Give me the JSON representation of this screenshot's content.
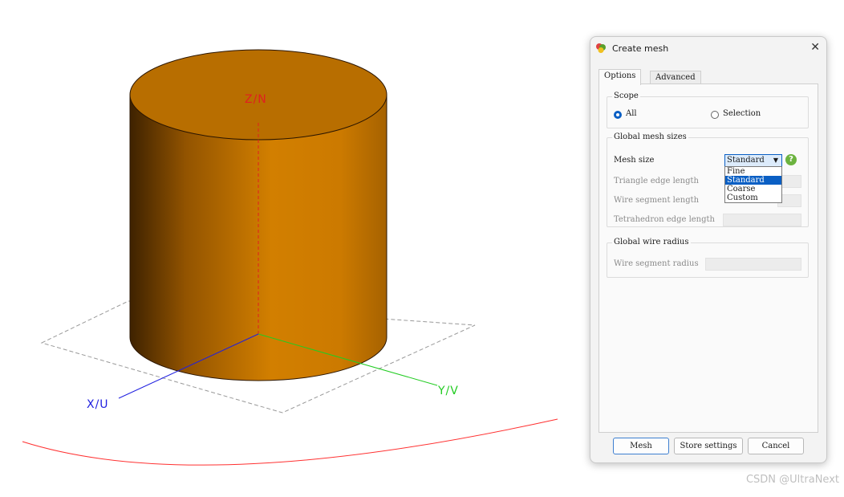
{
  "viewport": {
    "axis_labels": {
      "z": "Z/N",
      "y": "Y/V",
      "x": "X/U"
    },
    "colors": {
      "cylinder": "#c87c00",
      "cylinder_top": "#b86e00",
      "z_axis": "#e02020",
      "y_axis": "#22cc22",
      "x_axis": "#2020e0",
      "arc": "#ff3030"
    }
  },
  "dialog": {
    "title": "Create mesh",
    "icon": "app-logo-icon",
    "tabs": [
      {
        "label": "Options",
        "active": true
      },
      {
        "label": "Advanced",
        "active": false
      }
    ],
    "scope": {
      "legend": "Scope",
      "options": [
        {
          "label": "All",
          "checked": true
        },
        {
          "label": "Selection",
          "checked": false
        }
      ]
    },
    "global_mesh_sizes": {
      "legend": "Global mesh sizes",
      "mesh_size_label": "Mesh size",
      "mesh_size_value": "Standard",
      "dropdown_options": [
        "Fine",
        "Standard",
        "Coarse",
        "Custom"
      ],
      "dropdown_selected": "Standard",
      "fields": [
        {
          "label": "Triangle edge length",
          "value": ""
        },
        {
          "label": "Wire segment length",
          "value": ""
        },
        {
          "label": "Tetrahedron edge length",
          "value": ""
        }
      ]
    },
    "global_wire_radius": {
      "legend": "Global wire radius",
      "fields": [
        {
          "label": "Wire segment radius",
          "value": ""
        }
      ]
    },
    "buttons": {
      "mesh": "Mesh",
      "store_settings": "Store settings",
      "cancel": "Cancel"
    },
    "accent_color": "#0a5fc4"
  },
  "watermark": "CSDN @UltraNext"
}
